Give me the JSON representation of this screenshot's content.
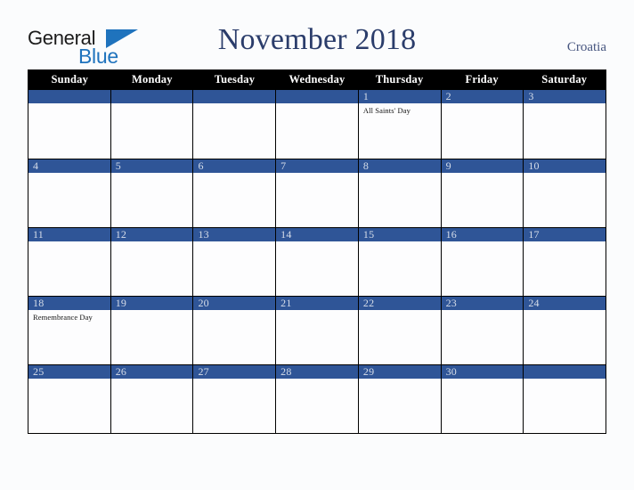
{
  "brand": {
    "name_part1": "General",
    "name_part2": "Blue",
    "color_black": "#1b1b1b",
    "color_blue": "#1f73bd"
  },
  "header": {
    "title": "November 2018",
    "region": "Croatia",
    "title_color": "#2b3d6b"
  },
  "calendar": {
    "month": "November",
    "year": "2018",
    "weekday_headers": [
      "Sunday",
      "Monday",
      "Tuesday",
      "Wednesday",
      "Thursday",
      "Friday",
      "Saturday"
    ],
    "header_bg": "#000000",
    "day_bar_color": "#2f5597",
    "day_number_color": "#d6dde9",
    "weeks": [
      [
        {
          "day": "",
          "events": []
        },
        {
          "day": "",
          "events": []
        },
        {
          "day": "",
          "events": []
        },
        {
          "day": "",
          "events": []
        },
        {
          "day": "1",
          "events": [
            "All Saints' Day"
          ]
        },
        {
          "day": "2",
          "events": []
        },
        {
          "day": "3",
          "events": []
        }
      ],
      [
        {
          "day": "4",
          "events": []
        },
        {
          "day": "5",
          "events": []
        },
        {
          "day": "6",
          "events": []
        },
        {
          "day": "7",
          "events": []
        },
        {
          "day": "8",
          "events": []
        },
        {
          "day": "9",
          "events": []
        },
        {
          "day": "10",
          "events": []
        }
      ],
      [
        {
          "day": "11",
          "events": []
        },
        {
          "day": "12",
          "events": []
        },
        {
          "day": "13",
          "events": []
        },
        {
          "day": "14",
          "events": []
        },
        {
          "day": "15",
          "events": []
        },
        {
          "day": "16",
          "events": []
        },
        {
          "day": "17",
          "events": []
        }
      ],
      [
        {
          "day": "18",
          "events": [
            "Remembrance Day"
          ]
        },
        {
          "day": "19",
          "events": []
        },
        {
          "day": "20",
          "events": []
        },
        {
          "day": "21",
          "events": []
        },
        {
          "day": "22",
          "events": []
        },
        {
          "day": "23",
          "events": []
        },
        {
          "day": "24",
          "events": []
        }
      ],
      [
        {
          "day": "25",
          "events": []
        },
        {
          "day": "26",
          "events": []
        },
        {
          "day": "27",
          "events": []
        },
        {
          "day": "28",
          "events": []
        },
        {
          "day": "29",
          "events": []
        },
        {
          "day": "30",
          "events": []
        },
        {
          "day": "",
          "events": []
        }
      ]
    ]
  }
}
